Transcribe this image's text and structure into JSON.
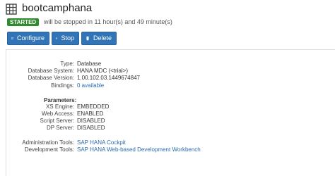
{
  "header": {
    "title": "bootcamphana",
    "icon": "database-icon"
  },
  "status": {
    "badge": "STARTED",
    "badge_color": "#2e8b2e",
    "note": "will be stopped in 11 hour(s) and 49 minute(s)"
  },
  "toolbar": {
    "configure_label": "Configure",
    "stop_label": "Stop",
    "delete_label": "Delete",
    "accent": "#3174b8"
  },
  "details": {
    "type": {
      "label": "Type:",
      "value": "Database"
    },
    "system": {
      "label": "Database System:",
      "value": "HANA MDC (<trial>)"
    },
    "version": {
      "label": "Database Version:",
      "value": "1.00.102.03.1449674847"
    },
    "bindings": {
      "label": "Bindings:",
      "value": "0 available"
    }
  },
  "parameters": {
    "heading": "Parameters:",
    "xs_engine": {
      "label": "XS Engine:",
      "value": "EMBEDDED"
    },
    "web_access": {
      "label": "Web Access:",
      "value": "ENABLED"
    },
    "script_server": {
      "label": "Script Server:",
      "value": "DISABLED"
    },
    "dp_server": {
      "label": "DP Server:",
      "value": "DISABLED"
    }
  },
  "tools": {
    "admin": {
      "label": "Administration Tools:",
      "value": "SAP HANA Cockpit"
    },
    "dev": {
      "label": "Development Tools:",
      "value": "SAP HANA Web-based Development Workbench"
    }
  }
}
